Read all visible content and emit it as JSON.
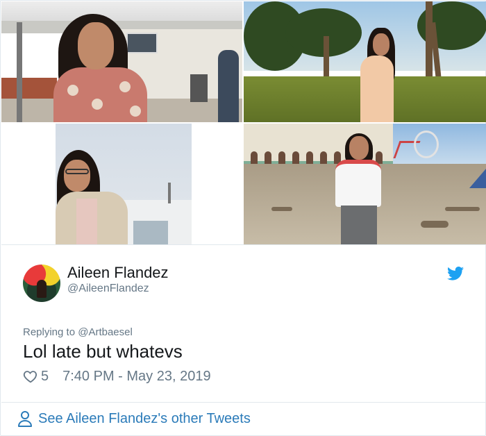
{
  "tweet": {
    "author_name": "Aileen Flandez",
    "author_handle": "@AileenFlandez",
    "replying_prefix": "Replying to",
    "replying_to": "@Artbaesel",
    "text": "Lol late but whatevs",
    "like_count": "5",
    "timestamp": "7:40 PM - May 23, 2019"
  },
  "footer": {
    "see_more_label": "See Aileen Flandez's other Tweets"
  },
  "icons": {
    "bird": "twitter-bird-icon",
    "heart": "heart-icon",
    "person": "person-icon"
  },
  "colors": {
    "twitter_blue": "#1da1f2",
    "link_blue": "#2b7bb9",
    "secondary_text": "#657786"
  }
}
